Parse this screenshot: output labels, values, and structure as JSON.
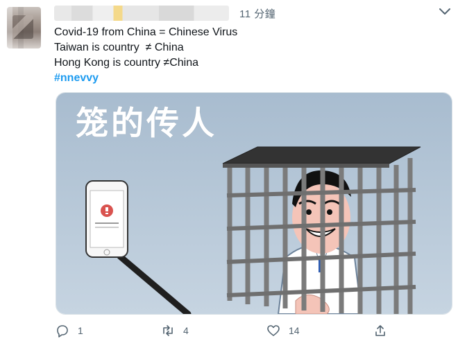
{
  "tweet": {
    "timestamp": "11 分鐘",
    "lines": [
      "Covid-19 from China = Chinese Virus",
      "Taiwan is country  ≠ China",
      "Hong Kong is country ≠China"
    ],
    "hashtag": "#nnevvy",
    "media": {
      "title": "笼的传人"
    }
  },
  "actions": {
    "reply_count": "1",
    "retweet_count": "4",
    "like_count": "14"
  },
  "colors": {
    "hashtag": "#1d9bf0",
    "secondary_text": "#536471",
    "media_background": "#b4c6d8"
  }
}
